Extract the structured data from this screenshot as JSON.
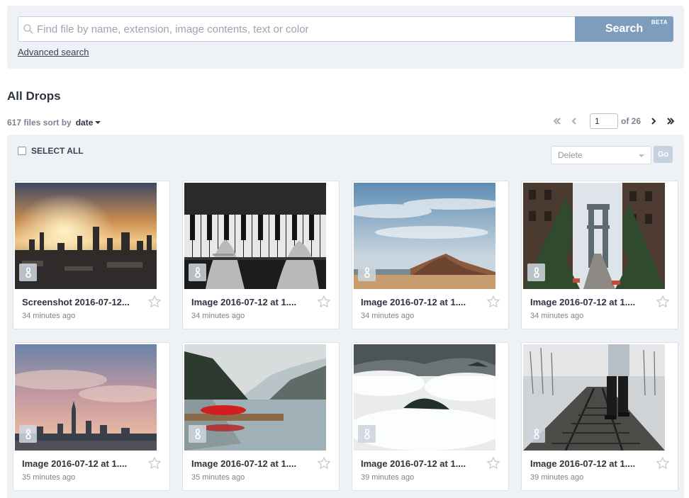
{
  "search": {
    "placeholder": "Find file by name, extension, image contents, text or color",
    "button_label": "Search",
    "beta_badge": "BETA",
    "advanced_link": "Advanced search"
  },
  "page": {
    "title": "All Drops",
    "file_count": "617 files sort by",
    "sort_value": "date"
  },
  "pagination": {
    "current_page": "1",
    "of_label": "of 26",
    "first_icon": "double-chevron-left-icon",
    "prev_icon": "chevron-left-icon",
    "next_icon": "chevron-right-icon",
    "last_icon": "double-chevron-right-icon"
  },
  "toolbar": {
    "select_all_label": "SELECT ALL",
    "action_selected": "Delete",
    "go_label": "Go"
  },
  "files": [
    {
      "name": "Screenshot 2016-07-12...",
      "time": "34 minutes ago",
      "subject": "city-sunset"
    },
    {
      "name": "Image 2016-07-12 at 1....",
      "time": "34 minutes ago",
      "subject": "piano-hands"
    },
    {
      "name": "Image 2016-07-12 at 1....",
      "time": "34 minutes ago",
      "subject": "desert-mountain"
    },
    {
      "name": "Image 2016-07-12 at 1....",
      "time": "34 minutes ago",
      "subject": "bridge-street"
    },
    {
      "name": "Image 2016-07-12 at 1....",
      "time": "35 minutes ago",
      "subject": "city-skyline-clouds"
    },
    {
      "name": "Image 2016-07-12 at 1....",
      "time": "35 minutes ago",
      "subject": "lake-red-boat"
    },
    {
      "name": "Image 2016-07-12 at 1....",
      "time": "39 minutes ago",
      "subject": "island-fog"
    },
    {
      "name": "Image 2016-07-12 at 1....",
      "time": "39 minutes ago",
      "subject": "railway-walker"
    }
  ],
  "icons": {
    "preview": "eye-icon",
    "favorite": "star-icon",
    "search": "search-icon"
  }
}
